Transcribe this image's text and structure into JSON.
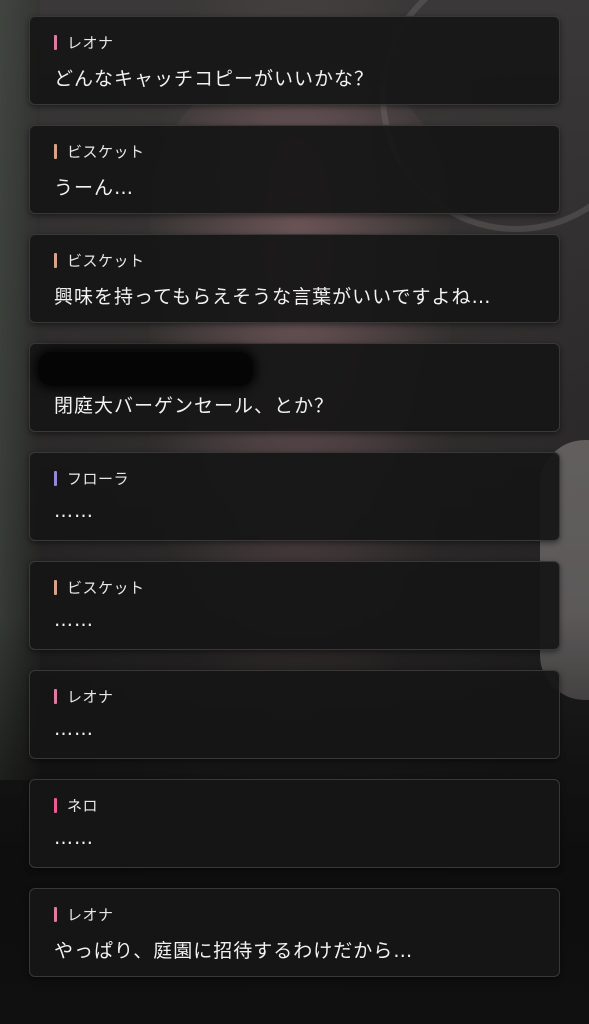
{
  "log": [
    {
      "speaker": "レオナ",
      "text": "どんなキャッチコピーがいいかな？",
      "color": "#e07aa0"
    },
    {
      "speaker": "ビスケット",
      "text": "うーん…",
      "color": "#d9a28a"
    },
    {
      "speaker": "ビスケット",
      "text": "興味を持ってもらえそうな言葉がいいですよね…",
      "color": "#d9a28a"
    },
    {
      "speaker": "",
      "text": "閉庭大バーゲンセール、とか？",
      "color": ""
    },
    {
      "speaker": "フローラ",
      "text": "……",
      "color": "#9a86d6"
    },
    {
      "speaker": "ビスケット",
      "text": "……",
      "color": "#d9a28a"
    },
    {
      "speaker": "レオナ",
      "text": "……",
      "color": "#e07aa0"
    },
    {
      "speaker": "ネロ",
      "text": "……",
      "color": "#ee5a92"
    },
    {
      "speaker": "レオナ",
      "text": "やっぱり、庭園に招待するわけだから…",
      "color": "#e07aa0"
    }
  ]
}
